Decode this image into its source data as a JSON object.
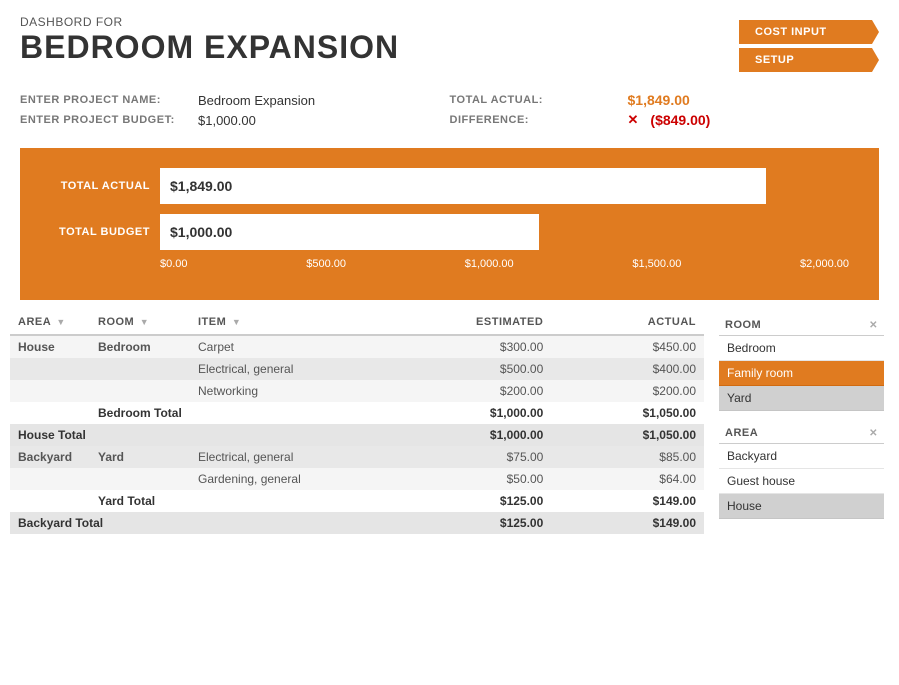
{
  "header": {
    "subtitle": "DASHBORD FOR",
    "title": "BEDROOM EXPANSION",
    "nav_buttons": [
      {
        "id": "cost-input",
        "label": "COST INPUT"
      },
      {
        "id": "setup",
        "label": "SETUP"
      }
    ]
  },
  "project": {
    "name_label": "ENTER PROJECT NAME:",
    "name_value": "Bedroom Expansion",
    "budget_label": "ENTER PROJECT BUDGET:",
    "budget_value": "$1,000.00",
    "total_actual_label": "TOTAL ACTUAL:",
    "total_actual_value": "$1,849.00",
    "difference_label": "DIFFERENCE:",
    "difference_value": "($849.00)"
  },
  "chart": {
    "actual_label": "TOTAL ACTUAL",
    "actual_value": "$1,849.00",
    "budget_label": "TOTAL BUDGET",
    "budget_value": "$1,000.00",
    "xaxis": [
      "$0.00",
      "$500.00",
      "$1,000.00",
      "$1,500.00",
      "$2,000.00"
    ]
  },
  "table": {
    "columns": [
      "AREA",
      "ROOM",
      "ITEM",
      "ESTIMATED",
      "ACTUAL"
    ],
    "rows": [
      {
        "type": "data",
        "area": "House",
        "room": "Bedroom",
        "item": "Carpet",
        "estimated": "$300.00",
        "actual": "$450.00"
      },
      {
        "type": "data",
        "area": "",
        "room": "",
        "item": "Electrical, general",
        "estimated": "$500.00",
        "actual": "$400.00"
      },
      {
        "type": "data",
        "area": "",
        "room": "",
        "item": "Networking",
        "estimated": "$200.00",
        "actual": "$200.00"
      },
      {
        "type": "subtotal",
        "area": "",
        "room": "Bedroom Total",
        "item": "",
        "estimated": "$1,000.00",
        "actual": "$1,050.00"
      },
      {
        "type": "areatotal",
        "area": "House Total",
        "room": "",
        "item": "",
        "estimated": "$1,000.00",
        "actual": "$1,050.00"
      },
      {
        "type": "data",
        "area": "Backyard",
        "room": "Yard",
        "item": "Electrical, general",
        "estimated": "$75.00",
        "actual": "$85.00"
      },
      {
        "type": "data",
        "area": "",
        "room": "",
        "item": "Gardening, general",
        "estimated": "$50.00",
        "actual": "$64.00"
      },
      {
        "type": "subtotal",
        "area": "",
        "room": "Yard Total",
        "item": "",
        "estimated": "$125.00",
        "actual": "$149.00"
      },
      {
        "type": "areatotal",
        "area": "Backyard Total",
        "room": "",
        "item": "",
        "estimated": "$125.00",
        "actual": "$149.00"
      }
    ]
  },
  "side_panel": {
    "room_header": "ROOM",
    "room_items": [
      {
        "label": "Bedroom",
        "style": "normal"
      },
      {
        "label": "Family room",
        "style": "highlight"
      },
      {
        "label": "Yard",
        "style": "gray"
      }
    ],
    "area_header": "AREA",
    "area_items": [
      {
        "label": "Backyard",
        "style": "normal"
      },
      {
        "label": "Guest house",
        "style": "normal"
      },
      {
        "label": "House",
        "style": "gray"
      }
    ]
  }
}
